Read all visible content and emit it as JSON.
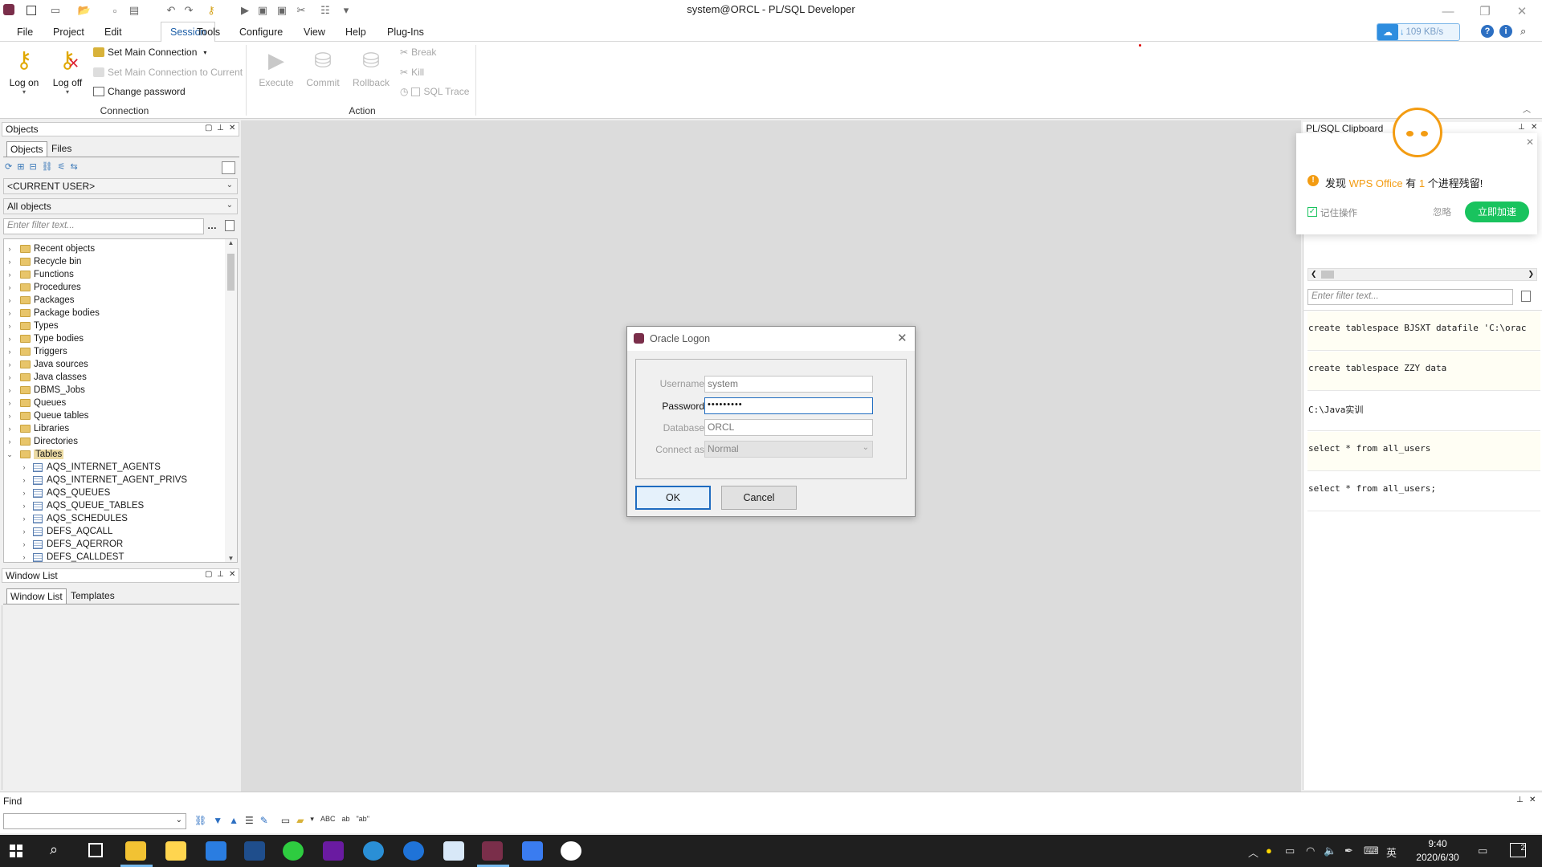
{
  "window": {
    "title": "system@ORCL - PL/SQL Developer"
  },
  "menu": [
    "File",
    "Project",
    "Edit",
    "Session",
    "Tools",
    "Configure",
    "View",
    "Help",
    "Plug-Ins"
  ],
  "network_widget": {
    "speed": "109 KB/s"
  },
  "ribbon": {
    "log_on": "Log on",
    "log_off": "Log off",
    "set_main_connection": "Set Main Connection",
    "set_main_connection_current": "Set Main Connection to Current",
    "change_password": "Change password",
    "connection_group": "Connection",
    "execute": "Execute",
    "commit": "Commit",
    "rollback": "Rollback",
    "break": "Break",
    "kill": "Kill",
    "sql_trace": "SQL Trace",
    "action_group": "Action"
  },
  "objects_panel": {
    "title": "Objects",
    "tabs": [
      "Objects",
      "Files"
    ],
    "user_select": "<CURRENT USER>",
    "filter_select": "All objects",
    "filter_placeholder": "Enter filter text...",
    "folders": [
      "Recent objects",
      "Recycle bin",
      "Functions",
      "Procedures",
      "Packages",
      "Package bodies",
      "Types",
      "Type bodies",
      "Triggers",
      "Java sources",
      "Java classes",
      "DBMS_Jobs",
      "Queues",
      "Queue tables",
      "Libraries",
      "Directories",
      "Tables"
    ],
    "tables": [
      "AQS_INTERNET_AGENTS",
      "AQS_INTERNET_AGENT_PRIVS",
      "AQS_QUEUES",
      "AQS_QUEUE_TABLES",
      "AQS_SCHEDULES",
      "DEFS_AQCALL",
      "DEFS_AQERROR",
      "DEFS_CALLDEST"
    ]
  },
  "window_list_panel": {
    "title": "Window List",
    "tabs": [
      "Window List",
      "Templates"
    ]
  },
  "dialog": {
    "title": "Oracle Logon",
    "username_label": "Username",
    "username_value": "system",
    "password_label": "Password",
    "password_value": "•••••••••",
    "database_label": "Database",
    "database_value": "ORCL",
    "connect_as_label": "Connect as",
    "connect_as_value": "Normal",
    "ok": "OK",
    "cancel": "Cancel"
  },
  "clipboard_panel": {
    "title": "PL/SQL Clipboard",
    "filter_placeholder": "Enter filter text...",
    "items": [
      "create tablespace BJSXT datafile 'C:\\orac",
      "create tablespace ZZY data",
      "C:\\Java实训",
      "select * from all_users",
      "select * from all_users;"
    ]
  },
  "wps_popup": {
    "message_prefix": "发现",
    "brand": "WPS Office",
    "message_mid": "有",
    "count": "1",
    "message_suffix": "个进程残留!",
    "remember": "记住操作",
    "ignore": "忽略",
    "accelerate": "立即加速"
  },
  "find_bar": {
    "title": "Find"
  },
  "taskbar": {
    "time": "9:40",
    "date": "2020/6/30",
    "ime": "英",
    "notif_count": "2"
  },
  "colors": {
    "wps_orange": "#f39c12",
    "accelerate_green": "#19c35e",
    "selection": "#ecdba4",
    "taskbar": "#1f1f1f"
  }
}
